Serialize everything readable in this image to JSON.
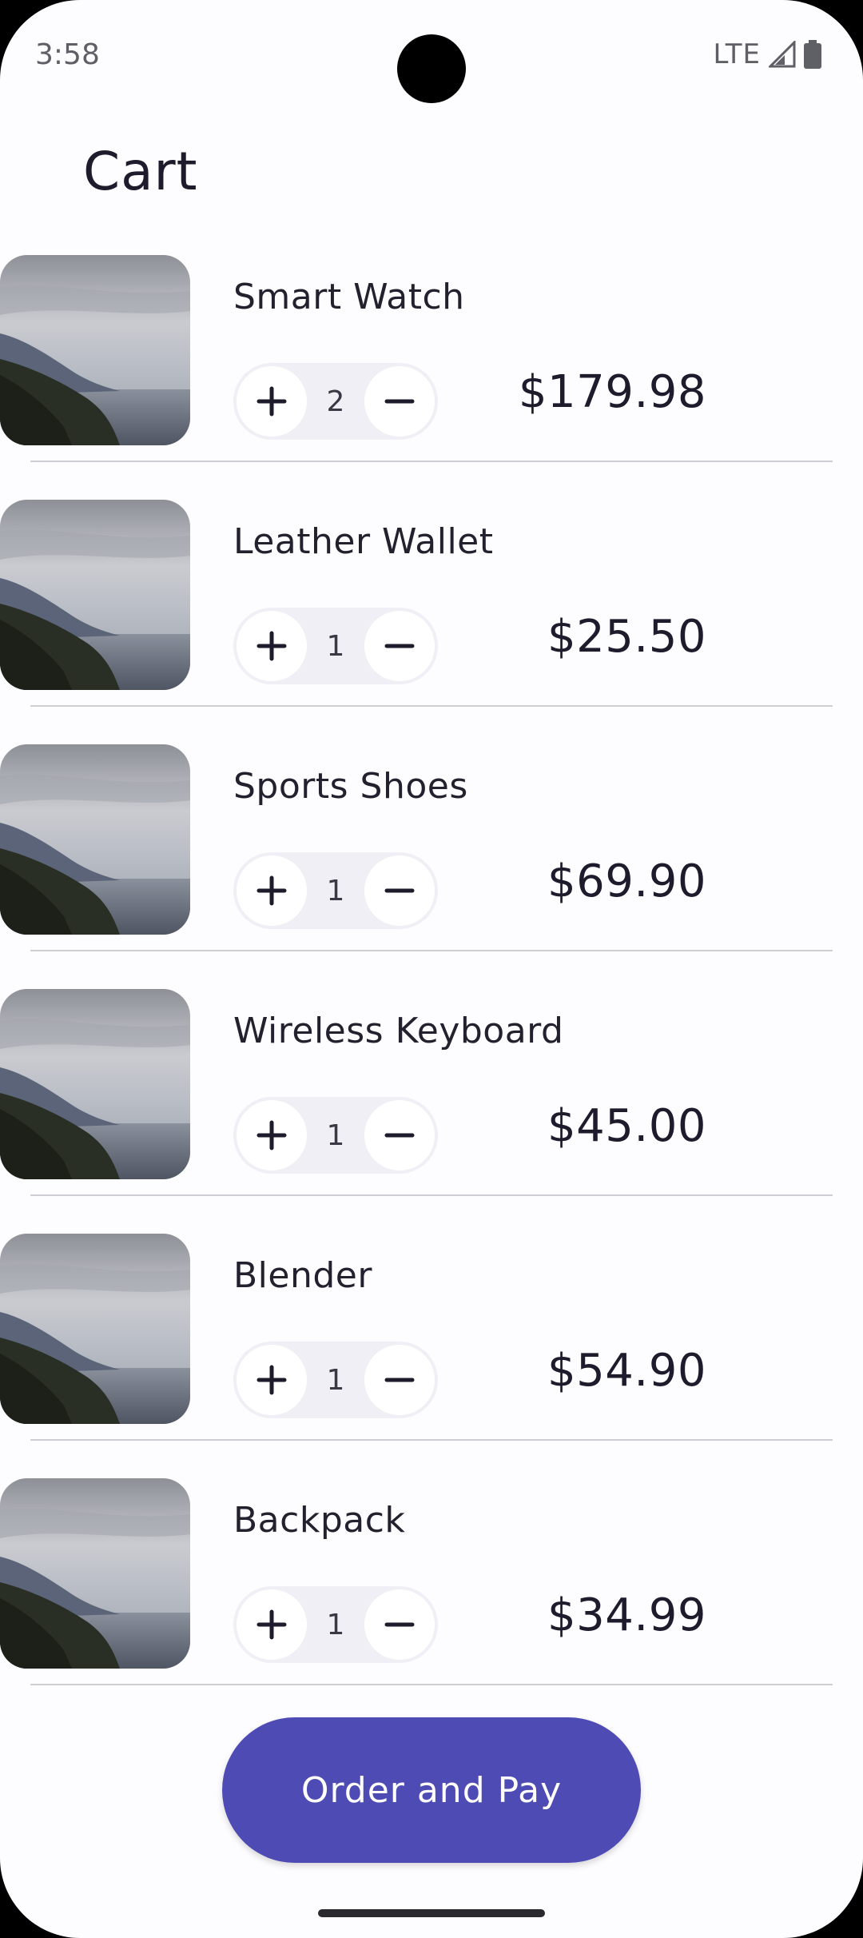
{
  "status_bar": {
    "time": "3:58",
    "network": "LTE",
    "icons": [
      "signal-icon",
      "battery-icon"
    ]
  },
  "page": {
    "title": "Cart"
  },
  "cart": {
    "items": [
      {
        "name": "Smart Watch",
        "quantity": "2",
        "price": "$179.98"
      },
      {
        "name": "Leather Wallet",
        "quantity": "1",
        "price": "$25.50"
      },
      {
        "name": "Sports Shoes",
        "quantity": "1",
        "price": "$69.90"
      },
      {
        "name": "Wireless Keyboard",
        "quantity": "1",
        "price": "$45.00"
      },
      {
        "name": "Blender",
        "quantity": "1",
        "price": "$54.90"
      },
      {
        "name": "Backpack",
        "quantity": "1",
        "price": "$34.99"
      }
    ],
    "increment_icon": "plus-icon",
    "decrement_icon": "minus-icon"
  },
  "actions": {
    "order_label": "Order and Pay"
  },
  "colors": {
    "accent": "#4e4bb5",
    "background": "#fdfcfe",
    "text": "#1d1b2c",
    "stepper_bg": "#f0eff5"
  }
}
